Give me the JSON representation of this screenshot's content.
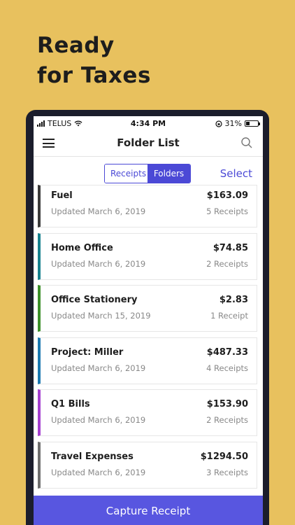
{
  "headline": {
    "line1": "Ready",
    "line2": "for Taxes"
  },
  "status_bar": {
    "carrier": "TELUS",
    "time": "4:34 PM",
    "battery": "31%",
    "battery_level": 0.31
  },
  "header": {
    "title": "Folder List",
    "menu_icon": "hamburger-menu-icon",
    "search_icon": "search-icon"
  },
  "segmented": {
    "receipts_label": "Receipts",
    "folders_label": "Folders",
    "selected": "Folders"
  },
  "select_label": "Select",
  "folders": [
    {
      "name": "Fuel",
      "updated": "Updated March 6, 2019",
      "amount": "$163.09",
      "count": "5 Receipts",
      "color": "#3a3a3a"
    },
    {
      "name": "Home Office",
      "updated": "Updated March 6, 2019",
      "amount": "$74.85",
      "count": "2 Receipts",
      "color": "#17808e"
    },
    {
      "name": "Office Stationery",
      "updated": "Updated March 15, 2019",
      "amount": "$2.83",
      "count": "1 Receipt",
      "color": "#3c8f2a"
    },
    {
      "name": "Project: Miller",
      "updated": "Updated March 6, 2019",
      "amount": "$487.33",
      "count": "4 Receipts",
      "color": "#1b78b0"
    },
    {
      "name": "Q1 Bills",
      "updated": "Updated March 6, 2019",
      "amount": "$153.90",
      "count": "2 Receipts",
      "color": "#a43fcf"
    },
    {
      "name": "Travel Expenses",
      "updated": "Updated March 6, 2019",
      "amount": "$1294.50",
      "count": "3 Receipts",
      "color": "#6e6e6e"
    }
  ],
  "capture_label": "Capture Receipt"
}
